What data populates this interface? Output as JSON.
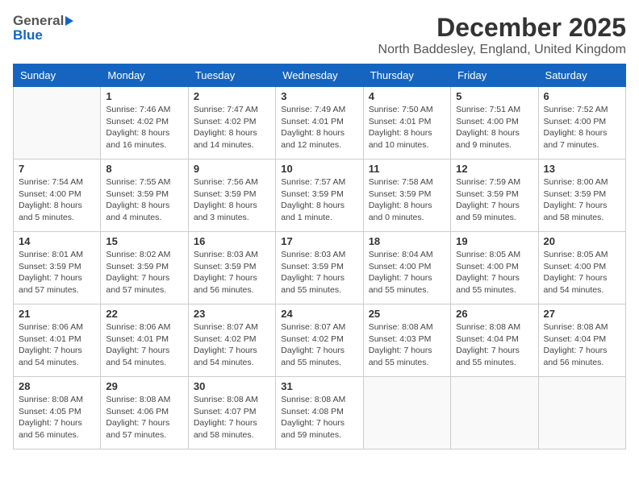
{
  "logo": {
    "general": "General",
    "blue": "Blue"
  },
  "title": "December 2025",
  "location": "North Baddesley, England, United Kingdom",
  "weekdays": [
    "Sunday",
    "Monday",
    "Tuesday",
    "Wednesday",
    "Thursday",
    "Friday",
    "Saturday"
  ],
  "weeks": [
    [
      {
        "day": "",
        "sunrise": "",
        "sunset": "",
        "daylight": ""
      },
      {
        "day": "1",
        "sunrise": "Sunrise: 7:46 AM",
        "sunset": "Sunset: 4:02 PM",
        "daylight": "Daylight: 8 hours and 16 minutes."
      },
      {
        "day": "2",
        "sunrise": "Sunrise: 7:47 AM",
        "sunset": "Sunset: 4:02 PM",
        "daylight": "Daylight: 8 hours and 14 minutes."
      },
      {
        "day": "3",
        "sunrise": "Sunrise: 7:49 AM",
        "sunset": "Sunset: 4:01 PM",
        "daylight": "Daylight: 8 hours and 12 minutes."
      },
      {
        "day": "4",
        "sunrise": "Sunrise: 7:50 AM",
        "sunset": "Sunset: 4:01 PM",
        "daylight": "Daylight: 8 hours and 10 minutes."
      },
      {
        "day": "5",
        "sunrise": "Sunrise: 7:51 AM",
        "sunset": "Sunset: 4:00 PM",
        "daylight": "Daylight: 8 hours and 9 minutes."
      },
      {
        "day": "6",
        "sunrise": "Sunrise: 7:52 AM",
        "sunset": "Sunset: 4:00 PM",
        "daylight": "Daylight: 8 hours and 7 minutes."
      }
    ],
    [
      {
        "day": "7",
        "sunrise": "Sunrise: 7:54 AM",
        "sunset": "Sunset: 4:00 PM",
        "daylight": "Daylight: 8 hours and 5 minutes."
      },
      {
        "day": "8",
        "sunrise": "Sunrise: 7:55 AM",
        "sunset": "Sunset: 3:59 PM",
        "daylight": "Daylight: 8 hours and 4 minutes."
      },
      {
        "day": "9",
        "sunrise": "Sunrise: 7:56 AM",
        "sunset": "Sunset: 3:59 PM",
        "daylight": "Daylight: 8 hours and 3 minutes."
      },
      {
        "day": "10",
        "sunrise": "Sunrise: 7:57 AM",
        "sunset": "Sunset: 3:59 PM",
        "daylight": "Daylight: 8 hours and 1 minute."
      },
      {
        "day": "11",
        "sunrise": "Sunrise: 7:58 AM",
        "sunset": "Sunset: 3:59 PM",
        "daylight": "Daylight: 8 hours and 0 minutes."
      },
      {
        "day": "12",
        "sunrise": "Sunrise: 7:59 AM",
        "sunset": "Sunset: 3:59 PM",
        "daylight": "Daylight: 7 hours and 59 minutes."
      },
      {
        "day": "13",
        "sunrise": "Sunrise: 8:00 AM",
        "sunset": "Sunset: 3:59 PM",
        "daylight": "Daylight: 7 hours and 58 minutes."
      }
    ],
    [
      {
        "day": "14",
        "sunrise": "Sunrise: 8:01 AM",
        "sunset": "Sunset: 3:59 PM",
        "daylight": "Daylight: 7 hours and 57 minutes."
      },
      {
        "day": "15",
        "sunrise": "Sunrise: 8:02 AM",
        "sunset": "Sunset: 3:59 PM",
        "daylight": "Daylight: 7 hours and 57 minutes."
      },
      {
        "day": "16",
        "sunrise": "Sunrise: 8:03 AM",
        "sunset": "Sunset: 3:59 PM",
        "daylight": "Daylight: 7 hours and 56 minutes."
      },
      {
        "day": "17",
        "sunrise": "Sunrise: 8:03 AM",
        "sunset": "Sunset: 3:59 PM",
        "daylight": "Daylight: 7 hours and 55 minutes."
      },
      {
        "day": "18",
        "sunrise": "Sunrise: 8:04 AM",
        "sunset": "Sunset: 4:00 PM",
        "daylight": "Daylight: 7 hours and 55 minutes."
      },
      {
        "day": "19",
        "sunrise": "Sunrise: 8:05 AM",
        "sunset": "Sunset: 4:00 PM",
        "daylight": "Daylight: 7 hours and 55 minutes."
      },
      {
        "day": "20",
        "sunrise": "Sunrise: 8:05 AM",
        "sunset": "Sunset: 4:00 PM",
        "daylight": "Daylight: 7 hours and 54 minutes."
      }
    ],
    [
      {
        "day": "21",
        "sunrise": "Sunrise: 8:06 AM",
        "sunset": "Sunset: 4:01 PM",
        "daylight": "Daylight: 7 hours and 54 minutes."
      },
      {
        "day": "22",
        "sunrise": "Sunrise: 8:06 AM",
        "sunset": "Sunset: 4:01 PM",
        "daylight": "Daylight: 7 hours and 54 minutes."
      },
      {
        "day": "23",
        "sunrise": "Sunrise: 8:07 AM",
        "sunset": "Sunset: 4:02 PM",
        "daylight": "Daylight: 7 hours and 54 minutes."
      },
      {
        "day": "24",
        "sunrise": "Sunrise: 8:07 AM",
        "sunset": "Sunset: 4:02 PM",
        "daylight": "Daylight: 7 hours and 55 minutes."
      },
      {
        "day": "25",
        "sunrise": "Sunrise: 8:08 AM",
        "sunset": "Sunset: 4:03 PM",
        "daylight": "Daylight: 7 hours and 55 minutes."
      },
      {
        "day": "26",
        "sunrise": "Sunrise: 8:08 AM",
        "sunset": "Sunset: 4:04 PM",
        "daylight": "Daylight: 7 hours and 55 minutes."
      },
      {
        "day": "27",
        "sunrise": "Sunrise: 8:08 AM",
        "sunset": "Sunset: 4:04 PM",
        "daylight": "Daylight: 7 hours and 56 minutes."
      }
    ],
    [
      {
        "day": "28",
        "sunrise": "Sunrise: 8:08 AM",
        "sunset": "Sunset: 4:05 PM",
        "daylight": "Daylight: 7 hours and 56 minutes."
      },
      {
        "day": "29",
        "sunrise": "Sunrise: 8:08 AM",
        "sunset": "Sunset: 4:06 PM",
        "daylight": "Daylight: 7 hours and 57 minutes."
      },
      {
        "day": "30",
        "sunrise": "Sunrise: 8:08 AM",
        "sunset": "Sunset: 4:07 PM",
        "daylight": "Daylight: 7 hours and 58 minutes."
      },
      {
        "day": "31",
        "sunrise": "Sunrise: 8:08 AM",
        "sunset": "Sunset: 4:08 PM",
        "daylight": "Daylight: 7 hours and 59 minutes."
      },
      {
        "day": "",
        "sunrise": "",
        "sunset": "",
        "daylight": ""
      },
      {
        "day": "",
        "sunrise": "",
        "sunset": "",
        "daylight": ""
      },
      {
        "day": "",
        "sunrise": "",
        "sunset": "",
        "daylight": ""
      }
    ]
  ]
}
